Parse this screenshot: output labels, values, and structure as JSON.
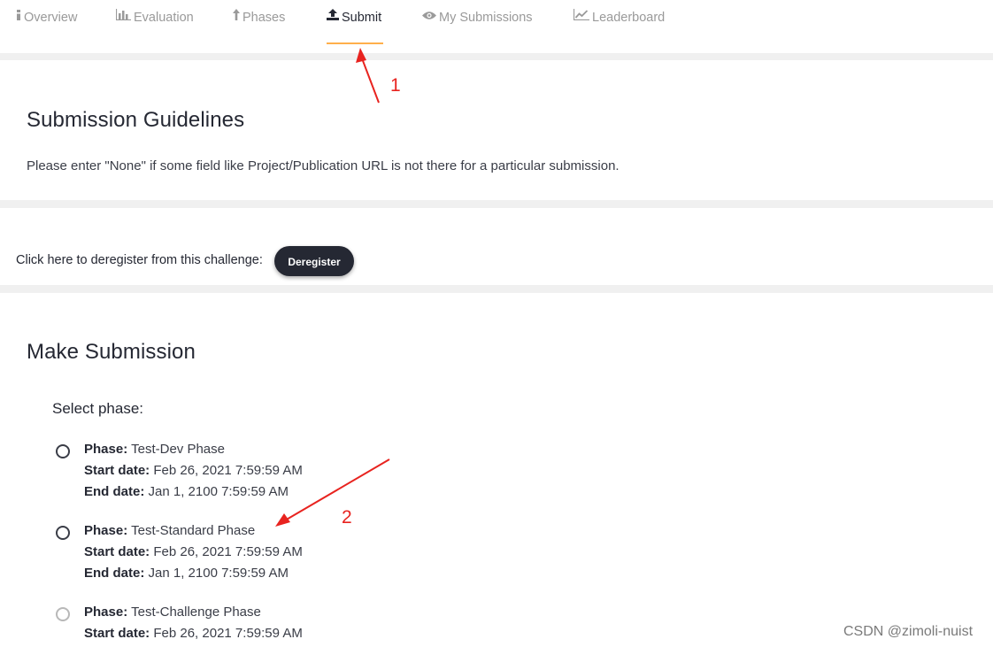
{
  "nav": {
    "tabs": [
      {
        "label": "Overview",
        "icon": "info-icon",
        "active": false
      },
      {
        "label": "Evaluation",
        "icon": "bar-chart-icon",
        "active": false
      },
      {
        "label": "Phases",
        "icon": "arrow-up-icon",
        "active": false
      },
      {
        "label": "Submit",
        "icon": "upload-icon",
        "active": true
      },
      {
        "label": "My Submissions",
        "icon": "eye-icon",
        "active": false
      },
      {
        "label": "Leaderboard",
        "icon": "line-chart-icon",
        "active": false
      }
    ],
    "active_color": "#ffaf4b"
  },
  "guidelines": {
    "title": "Submission Guidelines",
    "text": "Please enter \"None\" if some field like Project/Publication URL is not there for a particular submission."
  },
  "deregister": {
    "text": "Click here to deregister from this challenge:",
    "button_label": "Deregister"
  },
  "submission": {
    "title": "Make Submission",
    "select_label": "Select phase:",
    "field_labels": {
      "phase": "Phase:",
      "start": "Start date:",
      "end": "End date:"
    },
    "phases": [
      {
        "name": "Test-Dev Phase",
        "start": "Feb 26, 2021 7:59:59 AM",
        "end": "Jan 1, 2100 7:59:59 AM"
      },
      {
        "name": "Test-Standard Phase",
        "start": "Feb 26, 2021 7:59:59 AM",
        "end": "Jan 1, 2100 7:59:59 AM"
      },
      {
        "name": "Test-Challenge Phase",
        "start": "Feb 26, 2021 7:59:59 AM"
      }
    ]
  },
  "annotations": {
    "label_1": "1",
    "label_2": "2",
    "color": "#e8231f"
  },
  "watermark": "CSDN @zimoli-nuist"
}
